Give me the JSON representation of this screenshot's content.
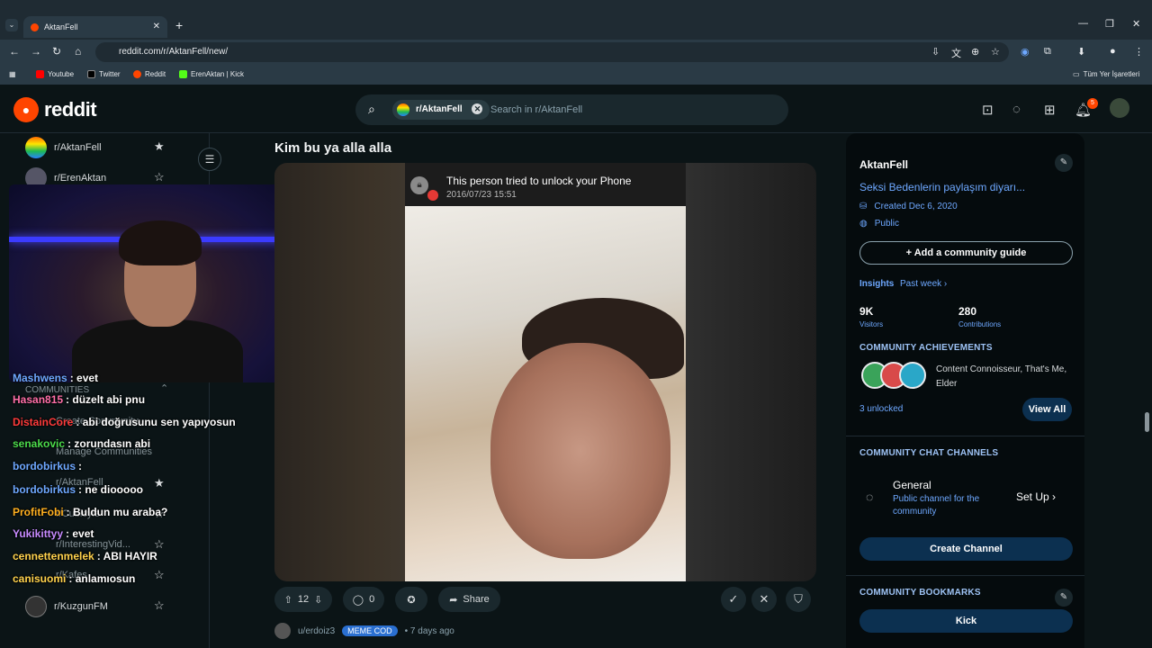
{
  "browser": {
    "tab_title": "AktanFell",
    "url": "reddit.com/r/AktanFell/new/",
    "bookmarks": [
      "Youtube",
      "Twitter",
      "Reddit",
      "ErenAktan | Kick"
    ],
    "all_bookmarks_label": "Tüm Yer İşaretleri"
  },
  "header": {
    "logo_text": "reddit",
    "search_chip": "r/AktanFell",
    "search_placeholder": "Search in r/AktanFell",
    "notification_count": "5"
  },
  "sidebar": {
    "top_items": [
      {
        "label": "r/AktanFell"
      },
      {
        "label": "r/ErenAktan"
      }
    ],
    "section_title": "COMMUNITIES",
    "create_label": "Create Community",
    "manage_label": "Manage Communities",
    "items": [
      {
        "label": "r/AktanFell"
      },
      {
        "label": "r/Cubicyle"
      },
      {
        "label": "r/InterestingVid..."
      },
      {
        "label": "r/Kafes"
      },
      {
        "label": "r/KuzgunFM"
      }
    ]
  },
  "chat": [
    {
      "user": "Mashwens",
      "msg": ": evet",
      "color": "#6ea8ff"
    },
    {
      "user": "Hasan815",
      "msg": ": düzelt abi pnu",
      "color": "#ff6fa8"
    },
    {
      "user": "DistainCore",
      "msg": ": abi doğrusunu sen yapıyosun",
      "color": "#ff3b3b"
    },
    {
      "user": "senakovic",
      "msg": ": zorundasın abi",
      "color": "#4cdc4c"
    },
    {
      "user": "bordobirkus",
      "msg": ":",
      "color": "#6ea8ff"
    },
    {
      "user": "bordobirkus",
      "msg": ": ne diooooo",
      "color": "#6ea8ff"
    },
    {
      "user": "ProfitFobi",
      "msg": ": Buldun mu araba?",
      "color": "#ffb020"
    },
    {
      "user": "Yukikittyy",
      "msg": ": evet",
      "color": "#c78bff"
    },
    {
      "user": "cennettenmelek",
      "msg": ": ABI HAYIR",
      "color": "#ffd24d"
    },
    {
      "user": "canisuomi",
      "msg": ": anlamıosun",
      "color": "#ffd24d"
    }
  ],
  "post": {
    "title": "Kim bu ya alla alla",
    "image_notification": "This person tried to unlock your Phone",
    "image_timestamp": "2016/07/23 15:51",
    "votes": "12",
    "comments": "0",
    "share_label": "Share"
  },
  "next_post": {
    "user": "u/erdoiz3",
    "flair": "MEME COD",
    "time": "• 7 days ago"
  },
  "about": {
    "name": "AktanFell",
    "description": "Seksi Bedenlerin paylaşım diyarı...",
    "created": "Created Dec 6, 2020",
    "visibility": "Public",
    "add_guide": "Add a community guide",
    "insights_label": "Insights",
    "insights_period": "Past week",
    "visitors_value": "9K",
    "visitors_label": "Visitors",
    "contributions_value": "280",
    "contributions_label": "Contributions",
    "achievements_title": "COMMUNITY ACHIEVEMENTS",
    "achievements_text": "Content Connoisseur, That's Me, Elder",
    "unlocked": "3 unlocked",
    "view_all": "View All",
    "chat_title": "COMMUNITY CHAT CHANNELS",
    "channel_name": "General",
    "channel_desc": "Public channel for the community",
    "setup_label": "Set Up",
    "create_channel": "Create Channel",
    "bookmarks_title": "COMMUNITY BOOKMARKS",
    "bookmark_button": "Kick"
  },
  "colors": {
    "reddit_orange": "#ff4500",
    "link_blue": "#6ea8ff",
    "button_blue": "#0c3050"
  }
}
